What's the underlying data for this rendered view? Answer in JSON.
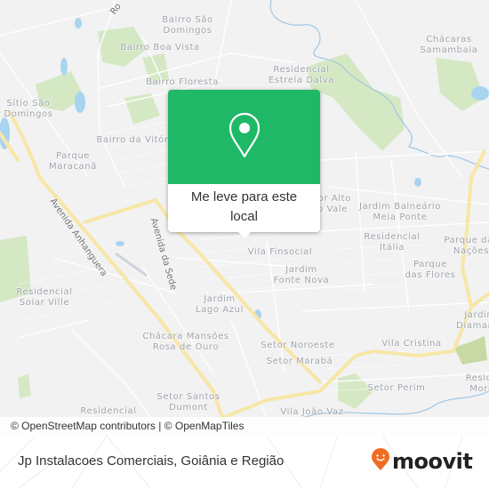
{
  "map": {
    "places": [
      {
        "id": "bairro-sao-domingos",
        "lines": [
          "Bairro São",
          "Domingos"
        ],
        "color": "#9ea3aa"
      },
      {
        "id": "bairro-boa-vista",
        "lines": [
          "Bairro Boa Vista"
        ]
      },
      {
        "id": "bairro-floresta",
        "lines": [
          "Bairro Floresta"
        ]
      },
      {
        "id": "residencial-estrela-dalva",
        "lines": [
          "Residencial",
          "Estrela Dalva"
        ]
      },
      {
        "id": "chacaras-samambaia",
        "lines": [
          "Chácaras",
          "Samambaia"
        ]
      },
      {
        "id": "sitio-sao-domingos",
        "lines": [
          "Sítio São",
          "Domingos"
        ]
      },
      {
        "id": "bairro-da-vitoria",
        "lines": [
          "Bairro da Vitór"
        ]
      },
      {
        "id": "parque-maracana",
        "lines": [
          "Parque",
          "Maracanã"
        ]
      },
      {
        "id": "setor-alto-vale",
        "lines": [
          "tor Alto",
          "o Vale"
        ]
      },
      {
        "id": "jardim-balneario-meia-ponte",
        "lines": [
          "Jardim Balneário",
          "Meia Ponte"
        ]
      },
      {
        "id": "residencial-italia",
        "lines": [
          "Residencial",
          "Itália"
        ]
      },
      {
        "id": "parque-das-nacoes",
        "lines": [
          "Parque das",
          "Nações"
        ]
      },
      {
        "id": "vila-finsocial",
        "lines": [
          "Vila Finsocial"
        ]
      },
      {
        "id": "jardim-fonte-nova",
        "lines": [
          "Jardim",
          "Fonte Nova"
        ]
      },
      {
        "id": "parque-das-flores",
        "lines": [
          "Parque",
          "das Flores"
        ]
      },
      {
        "id": "residencial-solar-ville",
        "lines": [
          "Residencial",
          "Solar Ville"
        ]
      },
      {
        "id": "jardim-lago-azul",
        "lines": [
          "Jardim",
          "Lago Azul"
        ]
      },
      {
        "id": "jardim-diamante",
        "lines": [
          "Jardim",
          "Diamante"
        ]
      },
      {
        "id": "chacara-mansoes-rosa-de-ouro",
        "lines": [
          "Chácara Mansões",
          "Rosa de Ouro"
        ]
      },
      {
        "id": "setor-noroeste",
        "lines": [
          "Setor Noroeste"
        ]
      },
      {
        "id": "vila-cristina",
        "lines": [
          "Vila Cristina"
        ]
      },
      {
        "id": "setor-maraba",
        "lines": [
          "Setor Marabá"
        ]
      },
      {
        "id": "setor-perim",
        "lines": [
          "Setor Perim"
        ]
      },
      {
        "id": "residencial-morumbi",
        "lines": [
          "Reside",
          "Moru"
        ]
      },
      {
        "id": "setor-santos-dumont",
        "lines": [
          "Setor Santos",
          "Dumont"
        ]
      },
      {
        "id": "residencial-bottom",
        "lines": [
          "Residencial"
        ]
      },
      {
        "id": "vila-joao-vaz",
        "lines": [
          "Vila João Vaz"
        ]
      }
    ],
    "streets": [
      {
        "id": "avenida-anhanguera",
        "label": "Avenida Anhanguera"
      },
      {
        "id": "avenida-da-sede",
        "label": "Avenida da Sede"
      },
      {
        "id": "top-road",
        "label": "Ro"
      }
    ],
    "colors": {
      "background": "#f2f2f3",
      "park": "#d5e8c4",
      "water": "#a8d4f0",
      "major_road": "#f7e7a6",
      "minor_road": "#ffffff"
    }
  },
  "popup": {
    "icon": "location-pin-icon",
    "label": "Me leve para este local",
    "header_color": "#1fb867"
  },
  "attribution": "© OpenStreetMap contributors | © OpenMapTiles",
  "footer": {
    "title": "Jp Instalacoes Comerciais, Goiânia e Região",
    "brand": "moovit",
    "brand_color": "#f26b21"
  }
}
